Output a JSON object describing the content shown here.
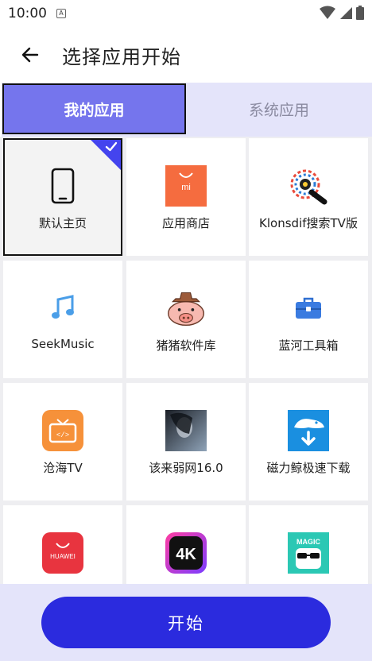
{
  "status": {
    "time": "10:00",
    "notification_letter": "A"
  },
  "header": {
    "title": "选择应用开始"
  },
  "tabs": [
    {
      "label": "我的应用",
      "active": true
    },
    {
      "label": "系统应用",
      "active": false
    }
  ],
  "apps": [
    {
      "label": "默认主页",
      "icon": "phone-icon",
      "selected": true
    },
    {
      "label": "应用商店",
      "icon": "mi-store-icon",
      "icon_text": "mi"
    },
    {
      "label": "Klonsdif搜索TV版",
      "icon": "klonsdif-icon"
    },
    {
      "label": "SeekMusic",
      "icon": "music-note-icon"
    },
    {
      "label": "猪猪软件库",
      "icon": "pig-icon"
    },
    {
      "label": "蓝河工具箱",
      "icon": "toolbox-icon"
    },
    {
      "label": "沧海TV",
      "icon": "tv-icon"
    },
    {
      "label": "该来弱网16.0",
      "icon": "photo-thumbnail-icon"
    },
    {
      "label": "磁力鲸极速下载",
      "icon": "whale-download-icon"
    },
    {
      "label": "",
      "icon": "huawei-icon",
      "icon_text": "HUAWEI"
    },
    {
      "label": "",
      "icon": "4k-icon",
      "icon_text": "4K"
    },
    {
      "label": "",
      "icon": "magic-icon",
      "icon_text": "MAGIC"
    }
  ],
  "footer": {
    "start_label": "开始"
  },
  "colors": {
    "accent": "#2b2bde",
    "tab_active": "#7575ed",
    "tab_bar": "#e4e4fa",
    "check": "#4444ee"
  }
}
